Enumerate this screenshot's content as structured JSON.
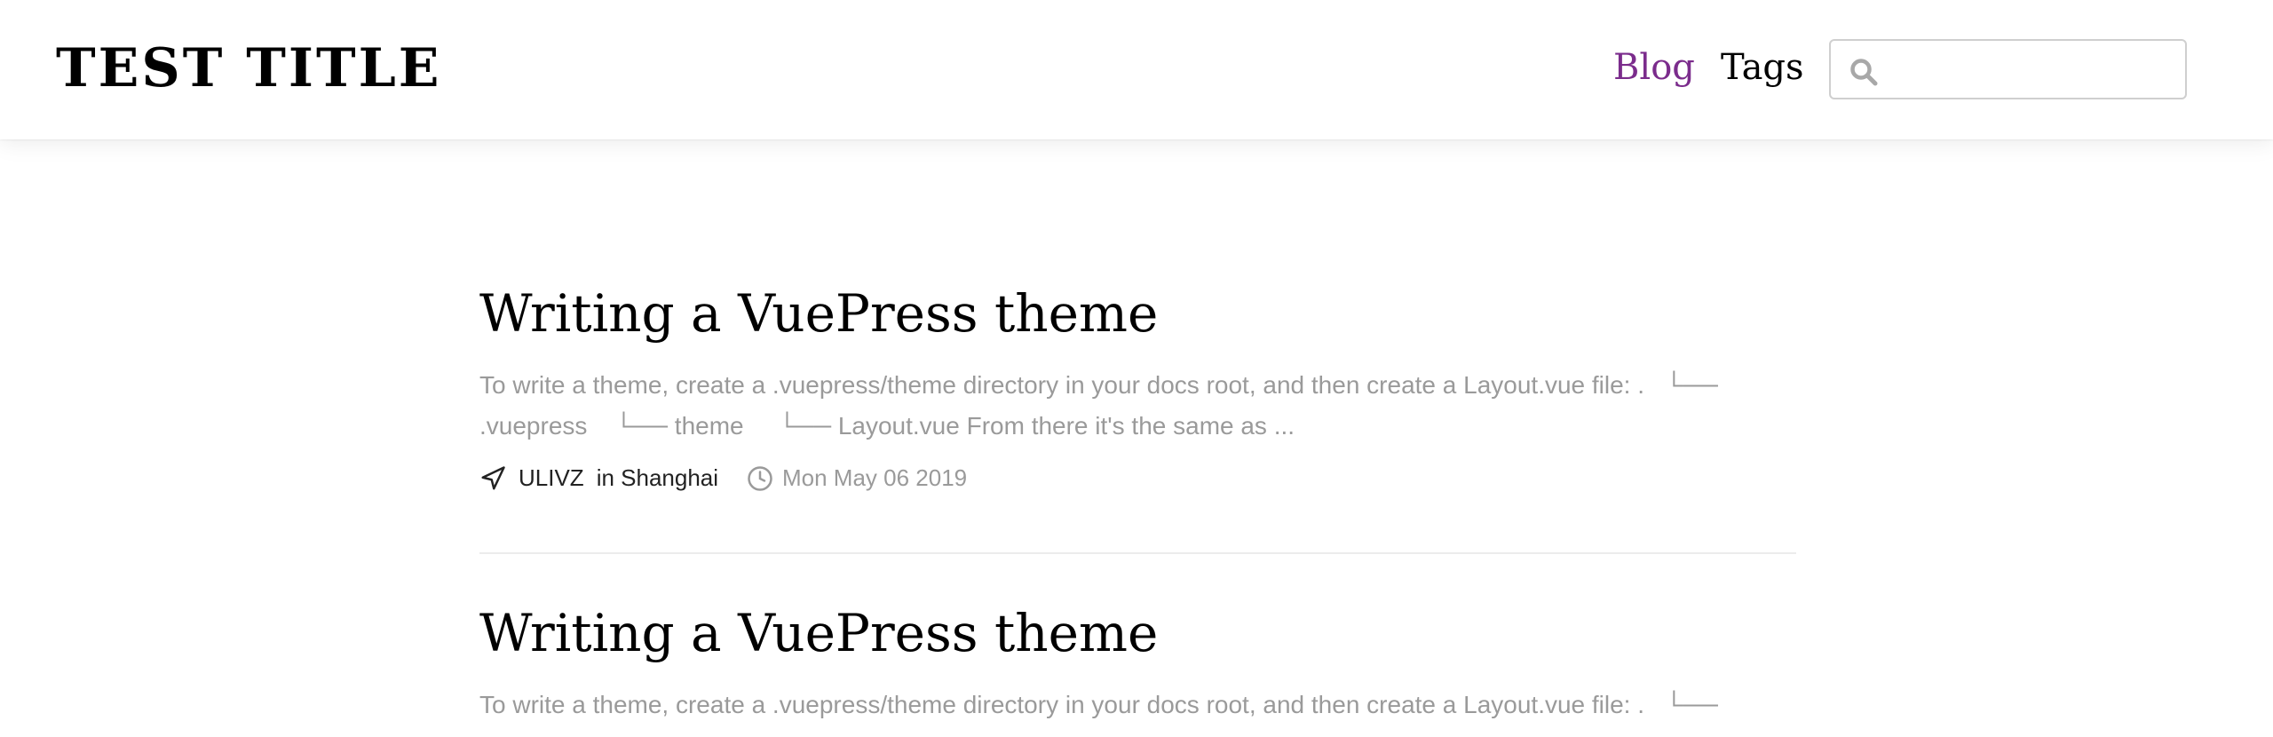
{
  "header": {
    "site_title": "TEST TITLE",
    "nav": [
      {
        "label": "Blog",
        "active": true
      },
      {
        "label": "Tags",
        "active": false
      }
    ],
    "search": {
      "value": "",
      "placeholder": ""
    }
  },
  "posts": [
    {
      "title": "Writing a VuePress theme",
      "summary": "To write a theme, create a .vuepress/theme directory in your docs root, and then create a Layout.vue file: .   └── .vuepress    └── theme     └── Layout.vue From there it's the same as ...",
      "author": "ULIVZ",
      "location": "in Shanghai",
      "date": "Mon May 06 2019"
    },
    {
      "title": "Writing a VuePress theme",
      "summary": "To write a theme, create a .vuepress/theme directory in your docs root, and then create a Layout.vue file: .   └──"
    }
  ],
  "colors": {
    "accent": "#7b2c8c",
    "text": "#000000",
    "muted": "#9a9a9a",
    "divider": "#ececec"
  },
  "icons": {
    "search": "search-icon",
    "author": "navigation-arrow-icon",
    "date": "clock-icon"
  }
}
